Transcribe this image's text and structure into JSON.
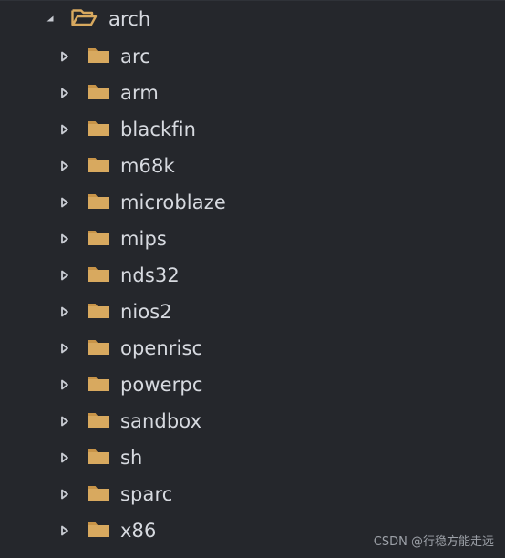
{
  "tree": {
    "root": {
      "label": "arch",
      "state": "expanded",
      "icon": "folder-open-icon",
      "arrow_icon": "caret-down-icon"
    },
    "children": [
      {
        "label": "arc"
      },
      {
        "label": "arm"
      },
      {
        "label": "blackfin"
      },
      {
        "label": "m68k"
      },
      {
        "label": "microblaze"
      },
      {
        "label": "mips"
      },
      {
        "label": "nds32"
      },
      {
        "label": "nios2"
      },
      {
        "label": "openrisc"
      },
      {
        "label": "powerpc"
      },
      {
        "label": "sandbox"
      },
      {
        "label": "sh"
      },
      {
        "label": "sparc"
      },
      {
        "label": "x86"
      }
    ],
    "child_icon": "folder-icon",
    "child_arrow_icon": "caret-right-icon"
  },
  "watermark": "CSDN @行稳方能走远",
  "colors": {
    "background": "#25272c",
    "text": "#d7dae0",
    "folder": "#d8a95f",
    "arrow": "#c9ccd3",
    "watermark": "#9da1a8"
  }
}
